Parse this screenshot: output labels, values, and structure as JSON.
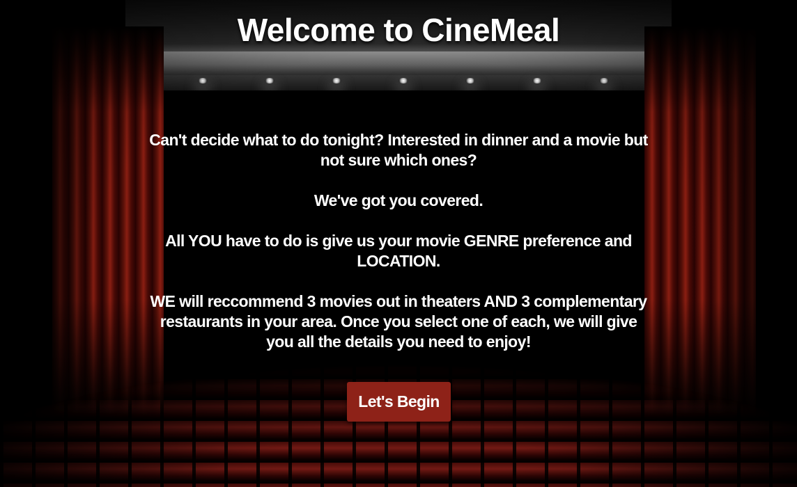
{
  "header": {
    "title": "Welcome to CineMeal"
  },
  "intro": {
    "paragraphs": [
      "Can't decide what to do tonight? Interested in dinner and a movie but not sure which ones?",
      "We've got you covered.",
      "All YOU have to do is give us your movie GENRE preference and LOCATION.",
      "WE will reccommend 3 movies out in theaters AND 3 complementary restaurants in your area. Once you select one of each, we will give you all the details you need to enjoy!"
    ]
  },
  "actions": {
    "begin_label": "Let's Begin"
  },
  "theme": {
    "button_color": "#8e2218",
    "curtain_color": "#8a1e12",
    "background": "#000000",
    "text_color": "#ffffff"
  }
}
